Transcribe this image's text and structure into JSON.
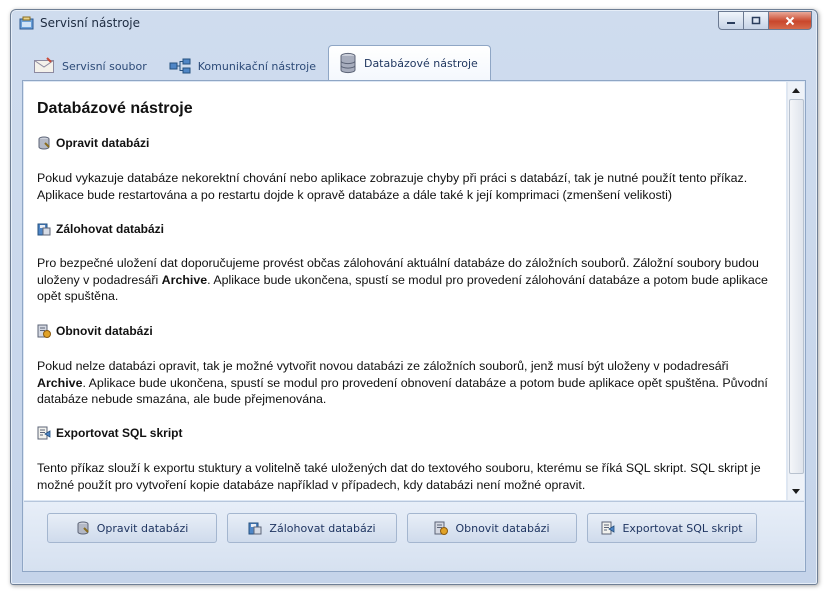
{
  "window": {
    "title": "Servisní nástroje"
  },
  "tabs": [
    {
      "label": "Servisní soubor",
      "icon": "envelope-icon",
      "active": false
    },
    {
      "label": "Komunikační nástroje",
      "icon": "network-icon",
      "active": false
    },
    {
      "label": "Databázové nástroje",
      "icon": "database-icon",
      "active": true
    }
  ],
  "content": {
    "heading": "Databázové nástroje",
    "sections": [
      {
        "title": "Opravit databázi",
        "icon": "database-repair-icon",
        "text": "Pokud vykazuje databáze nekorektní chování nebo aplikace zobrazuje chyby při práci s databází, tak je nutné použít tento příkaz. Aplikace bude restartována a po restartu dojde k opravě databáze a dále také k její komprimaci (zmenšení velikosti)"
      },
      {
        "title": "Zálohovat databázi",
        "icon": "database-backup-icon",
        "text_before": "Pro bezpečné uložení dat doporučujeme provést občas zálohování aktuální databáze do záložních souborů. Záložní soubory budou uloženy v podadresáři ",
        "text_bold": "Archive",
        "text_after": ". Aplikace bude ukončena, spustí se modul pro provedení zálohování databáze a potom bude aplikace opět spuštěna."
      },
      {
        "title": "Obnovit databázi",
        "icon": "database-restore-icon",
        "text_before": "Pokud nelze databázi opravit, tak je možné vytvořit novou databázi ze záložních souborů, jenž musí být uloženy v podadresáři ",
        "text_bold": "Archive",
        "text_after": ". Aplikace bude ukončena, spustí se modul pro provedení obnovení databáze a potom bude aplikace opět spuštěna. Původní databáze nebude smazána, ale bude přejmenována."
      },
      {
        "title": "Exportovat SQL skript",
        "icon": "sql-export-icon",
        "text": "Tento příkaz slouží k exportu stuktury a volitelně také uložených dat do textového souboru, kterému se říká SQL skript. SQL skript je možné použít pro vytvoření kopie databáze například v případech, kdy databázi není možné opravit."
      }
    ]
  },
  "buttons": [
    {
      "label": "Opravit databázi",
      "icon": "database-repair-icon"
    },
    {
      "label": "Zálohovat databázi",
      "icon": "database-backup-icon"
    },
    {
      "label": "Obnovit databázi",
      "icon": "database-restore-icon"
    },
    {
      "label": "Exportovat SQL skript",
      "icon": "sql-export-icon"
    }
  ],
  "colors": {
    "accent": "#2c4a78",
    "window_frame": "#c5d4ea",
    "close_button": "#c9462b"
  }
}
